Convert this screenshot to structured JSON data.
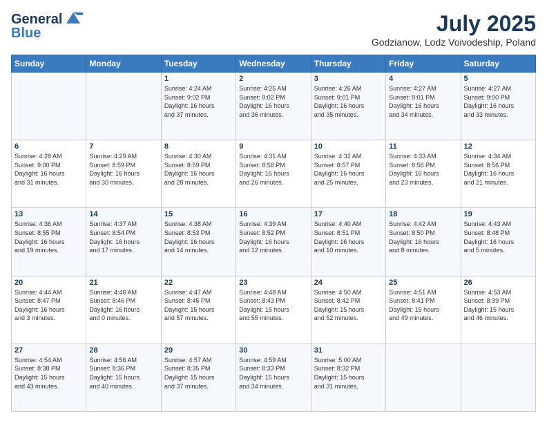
{
  "header": {
    "logo_line1": "General",
    "logo_line2": "Blue",
    "title": "July 2025",
    "subtitle": "Godzianow, Lodz Voivodeship, Poland"
  },
  "days_of_week": [
    "Sunday",
    "Monday",
    "Tuesday",
    "Wednesday",
    "Thursday",
    "Friday",
    "Saturday"
  ],
  "weeks": [
    [
      {
        "day": "",
        "info": ""
      },
      {
        "day": "",
        "info": ""
      },
      {
        "day": "1",
        "info": "Sunrise: 4:24 AM\nSunset: 9:02 PM\nDaylight: 16 hours\nand 37 minutes."
      },
      {
        "day": "2",
        "info": "Sunrise: 4:25 AM\nSunset: 9:02 PM\nDaylight: 16 hours\nand 36 minutes."
      },
      {
        "day": "3",
        "info": "Sunrise: 4:26 AM\nSunset: 9:01 PM\nDaylight: 16 hours\nand 35 minutes."
      },
      {
        "day": "4",
        "info": "Sunrise: 4:27 AM\nSunset: 9:01 PM\nDaylight: 16 hours\nand 34 minutes."
      },
      {
        "day": "5",
        "info": "Sunrise: 4:27 AM\nSunset: 9:00 PM\nDaylight: 16 hours\nand 33 minutes."
      }
    ],
    [
      {
        "day": "6",
        "info": "Sunrise: 4:28 AM\nSunset: 9:00 PM\nDaylight: 16 hours\nand 31 minutes."
      },
      {
        "day": "7",
        "info": "Sunrise: 4:29 AM\nSunset: 8:59 PM\nDaylight: 16 hours\nand 30 minutes."
      },
      {
        "day": "8",
        "info": "Sunrise: 4:30 AM\nSunset: 8:59 PM\nDaylight: 16 hours\nand 28 minutes."
      },
      {
        "day": "9",
        "info": "Sunrise: 4:31 AM\nSunset: 8:58 PM\nDaylight: 16 hours\nand 26 minutes."
      },
      {
        "day": "10",
        "info": "Sunrise: 4:32 AM\nSunset: 8:57 PM\nDaylight: 16 hours\nand 25 minutes."
      },
      {
        "day": "11",
        "info": "Sunrise: 4:33 AM\nSunset: 8:56 PM\nDaylight: 16 hours\nand 23 minutes."
      },
      {
        "day": "12",
        "info": "Sunrise: 4:34 AM\nSunset: 8:56 PM\nDaylight: 16 hours\nand 21 minutes."
      }
    ],
    [
      {
        "day": "13",
        "info": "Sunrise: 4:36 AM\nSunset: 8:55 PM\nDaylight: 16 hours\nand 19 minutes."
      },
      {
        "day": "14",
        "info": "Sunrise: 4:37 AM\nSunset: 8:54 PM\nDaylight: 16 hours\nand 17 minutes."
      },
      {
        "day": "15",
        "info": "Sunrise: 4:38 AM\nSunset: 8:53 PM\nDaylight: 16 hours\nand 14 minutes."
      },
      {
        "day": "16",
        "info": "Sunrise: 4:39 AM\nSunset: 8:52 PM\nDaylight: 16 hours\nand 12 minutes."
      },
      {
        "day": "17",
        "info": "Sunrise: 4:40 AM\nSunset: 8:51 PM\nDaylight: 16 hours\nand 10 minutes."
      },
      {
        "day": "18",
        "info": "Sunrise: 4:42 AM\nSunset: 8:50 PM\nDaylight: 16 hours\nand 8 minutes."
      },
      {
        "day": "19",
        "info": "Sunrise: 4:43 AM\nSunset: 8:48 PM\nDaylight: 16 hours\nand 5 minutes."
      }
    ],
    [
      {
        "day": "20",
        "info": "Sunrise: 4:44 AM\nSunset: 8:47 PM\nDaylight: 16 hours\nand 3 minutes."
      },
      {
        "day": "21",
        "info": "Sunrise: 4:46 AM\nSunset: 8:46 PM\nDaylight: 16 hours\nand 0 minutes."
      },
      {
        "day": "22",
        "info": "Sunrise: 4:47 AM\nSunset: 8:45 PM\nDaylight: 15 hours\nand 57 minutes."
      },
      {
        "day": "23",
        "info": "Sunrise: 4:48 AM\nSunset: 8:43 PM\nDaylight: 15 hours\nand 55 minutes."
      },
      {
        "day": "24",
        "info": "Sunrise: 4:50 AM\nSunset: 8:42 PM\nDaylight: 15 hours\nand 52 minutes."
      },
      {
        "day": "25",
        "info": "Sunrise: 4:51 AM\nSunset: 8:41 PM\nDaylight: 15 hours\nand 49 minutes."
      },
      {
        "day": "26",
        "info": "Sunrise: 4:53 AM\nSunset: 8:39 PM\nDaylight: 15 hours\nand 46 minutes."
      }
    ],
    [
      {
        "day": "27",
        "info": "Sunrise: 4:54 AM\nSunset: 8:38 PM\nDaylight: 15 hours\nand 43 minutes."
      },
      {
        "day": "28",
        "info": "Sunrise: 4:56 AM\nSunset: 8:36 PM\nDaylight: 15 hours\nand 40 minutes."
      },
      {
        "day": "29",
        "info": "Sunrise: 4:57 AM\nSunset: 8:35 PM\nDaylight: 15 hours\nand 37 minutes."
      },
      {
        "day": "30",
        "info": "Sunrise: 4:59 AM\nSunset: 8:33 PM\nDaylight: 15 hours\nand 34 minutes."
      },
      {
        "day": "31",
        "info": "Sunrise: 5:00 AM\nSunset: 8:32 PM\nDaylight: 15 hours\nand 31 minutes."
      },
      {
        "day": "",
        "info": ""
      },
      {
        "day": "",
        "info": ""
      }
    ]
  ]
}
